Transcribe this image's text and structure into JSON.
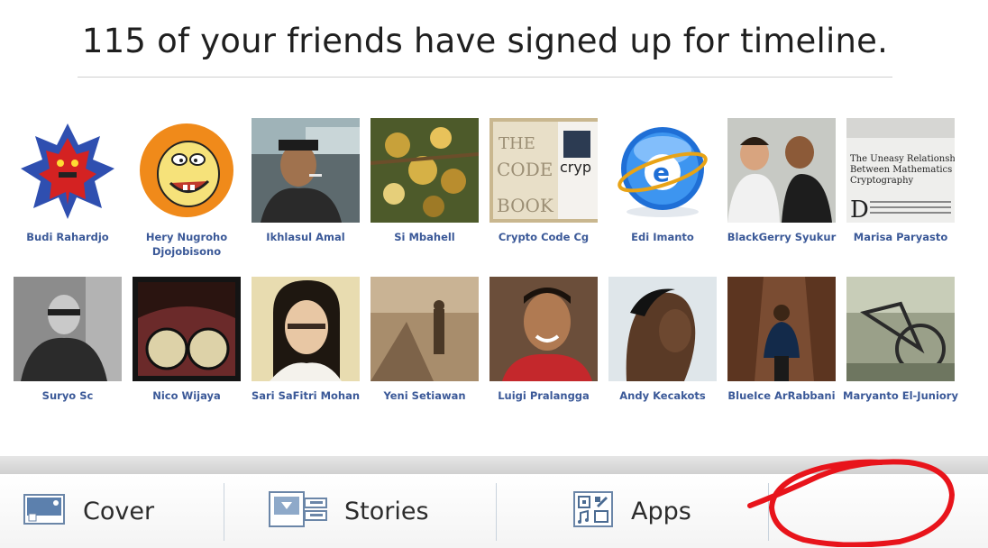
{
  "header": {
    "title": "115 of your friends have signed up for timeline."
  },
  "friends": [
    {
      "name": "Budi Rahardjo",
      "avatar": "robot-avatar"
    },
    {
      "name": "Hery Nugroho Djojobisono",
      "avatar": "cartoon-dog-avatar"
    },
    {
      "name": "Ikhlasul Amal",
      "avatar": "man-smoking-photo"
    },
    {
      "name": "Si Mbahell",
      "avatar": "rambutan-fruit-photo"
    },
    {
      "name": "Crypto Code Cg",
      "avatar": "code-book-photo"
    },
    {
      "name": "Edi Imanto",
      "avatar": "internet-explorer-icon"
    },
    {
      "name": "BlackGerry Syukur",
      "avatar": "man-and-child-photo"
    },
    {
      "name": "Marisa Paryasto",
      "avatar": "article-page-photo"
    },
    {
      "name": "Suryo Sc",
      "avatar": "man-glasses-bw-photo"
    },
    {
      "name": "Nico Wijaya",
      "avatar": "round-glasses-photo"
    },
    {
      "name": "Sari SaFitri Mohan",
      "avatar": "woman-glasses-photo"
    },
    {
      "name": "Yeni Setiawan",
      "avatar": "sepia-forest-photo"
    },
    {
      "name": "Luigi Pralangga",
      "avatar": "smiling-man-photo"
    },
    {
      "name": "Andy Kecakots",
      "avatar": "man-profile-photo"
    },
    {
      "name": "BlueIce ArRabbani",
      "avatar": "girl-in-cave-photo"
    },
    {
      "name": "Maryanto El-Juniory",
      "avatar": "bicycle-photo"
    }
  ],
  "toolbar": {
    "items": [
      {
        "label": "Cover",
        "icon": "cover-photo-icon"
      },
      {
        "label": "Stories",
        "icon": "stories-icon"
      },
      {
        "label": "Apps",
        "icon": "apps-icon"
      }
    ]
  },
  "colors": {
    "link": "#3b5998",
    "title": "#1f1f1f",
    "annotation": "#e8141b"
  }
}
